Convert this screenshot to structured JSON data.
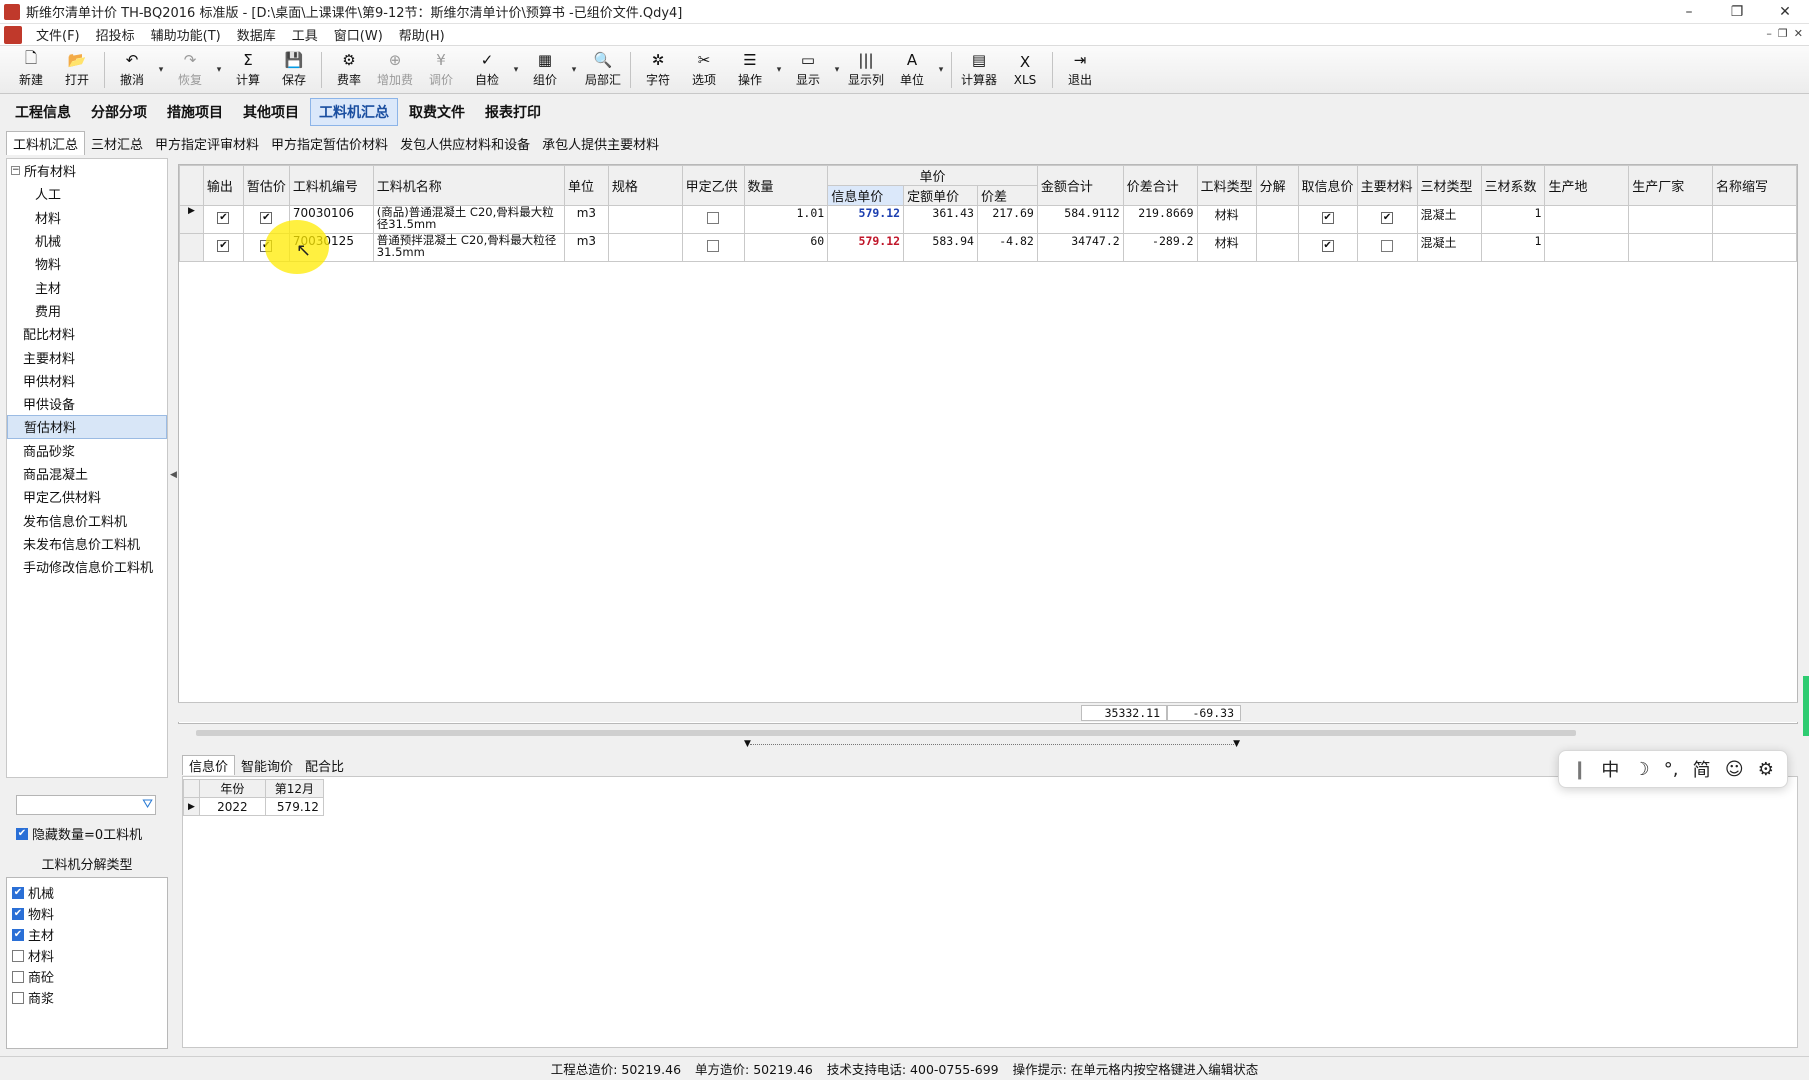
{
  "window": {
    "title": "斯维尔清单计价 TH-BQ2016 标准版 - [D:\\桌面\\上课课件\\第9-12节：斯维尔清单计价\\预算书 -已组价文件.Qdy4]",
    "minimize": "–",
    "maximize": "❐",
    "close": "✕"
  },
  "menu": {
    "items": [
      "文件(F)",
      "招投标",
      "辅助功能(T)",
      "数据库",
      "工具",
      "窗口(W)",
      "帮助(H)"
    ],
    "mdi": [
      "–",
      "❐",
      "✕"
    ]
  },
  "toolbar": {
    "buttons": [
      {
        "label": "新建",
        "icon": "new-file-icon",
        "glyph": "🗋"
      },
      {
        "label": "打开",
        "icon": "folder-open-icon",
        "glyph": "📂"
      },
      {
        "label": "撤消",
        "icon": "undo-icon",
        "glyph": "↶"
      },
      {
        "label": "恢复",
        "icon": "redo-icon",
        "glyph": "↷"
      },
      {
        "label": "计算",
        "icon": "sigma-icon",
        "glyph": "Σ"
      },
      {
        "label": "保存",
        "icon": "save-icon",
        "glyph": "💾"
      },
      {
        "label": "费率",
        "icon": "rate-icon",
        "glyph": "⚙"
      },
      {
        "label": "增加费",
        "icon": "add-fee-icon",
        "glyph": "⊕"
      },
      {
        "label": "调价",
        "icon": "price-adjust-icon",
        "glyph": "¥"
      },
      {
        "label": "自检",
        "icon": "self-check-icon",
        "glyph": "✓"
      },
      {
        "label": "组价",
        "icon": "compose-price-icon",
        "glyph": "▦"
      },
      {
        "label": "局部汇",
        "icon": "partial-summary-icon",
        "glyph": "🔍"
      },
      {
        "label": "字符",
        "icon": "symbol-icon",
        "glyph": "✲"
      },
      {
        "label": "选项",
        "icon": "options-icon",
        "glyph": "✂"
      },
      {
        "label": "操作",
        "icon": "operation-icon",
        "glyph": "☰"
      },
      {
        "label": "显示",
        "icon": "display-icon",
        "glyph": "▭"
      },
      {
        "label": "显示列",
        "icon": "columns-icon",
        "glyph": "|||"
      },
      {
        "label": "单位",
        "icon": "font-unit-icon",
        "glyph": "A"
      },
      {
        "label": "计算器",
        "icon": "calculator-icon",
        "glyph": "▤"
      },
      {
        "label": "XLS",
        "icon": "excel-icon",
        "glyph": "X"
      },
      {
        "label": "退出",
        "icon": "exit-icon",
        "glyph": "⇥"
      }
    ]
  },
  "main_tabs": [
    "工程信息",
    "分部分项",
    "措施项目",
    "其他项目",
    "工料机汇总",
    "取费文件",
    "报表打印"
  ],
  "sub_tabs": [
    "工料机汇总",
    "三材汇总",
    "甲方指定评审材料",
    "甲方指定暂估价材料",
    "发包人供应材料和设备",
    "承包人提供主要材料"
  ],
  "tree": {
    "root": "所有材料",
    "root_toggle": "−",
    "children": [
      "人工",
      "材料",
      "机械",
      "物料",
      "主材",
      "费用"
    ],
    "groups": [
      "配比材料",
      "主要材料",
      "甲供材料",
      "甲供设备",
      "暂估材料",
      "商品砂浆",
      "商品混凝土",
      "甲定乙供材料",
      "发布信息价工料机",
      "未发布信息价工料机",
      "手动修改信息价工料机"
    ],
    "selected": "暂估材料"
  },
  "filter": {
    "placeholder": "",
    "hide_zero_label": "隐藏数量=0工料机"
  },
  "decomposition": {
    "title": "工料机分解类型",
    "items": [
      {
        "label": "机械",
        "checked": true
      },
      {
        "label": "物料",
        "checked": true
      },
      {
        "label": "主材",
        "checked": true
      },
      {
        "label": "材料",
        "checked": false
      },
      {
        "label": "商砼",
        "checked": false
      },
      {
        "label": "商浆",
        "checked": false
      }
    ]
  },
  "grid": {
    "headers": {
      "output": "输出",
      "provisional": "暂估价",
      "code": "工料机编号",
      "name": "工料机名称",
      "unit": "单位",
      "spec": "规格",
      "owner_supply": "甲定乙供",
      "qty": "数量",
      "unit_price_group": "单价",
      "info_price": "信息单价",
      "quota_price": "定额单价",
      "diff": "价差",
      "amount": "金额合计",
      "diff_total": "价差合计",
      "type": "工料类型",
      "decompose": "分解",
      "take_info": "取信息价",
      "main_material": "主要材料",
      "three_type": "三材类型",
      "three_coef": "三材系数",
      "origin": "生产地",
      "maker": "生产厂家",
      "abbr": "名称缩写"
    },
    "rows": [
      {
        "code": "70030106",
        "name": "(商品)普通混凝土 C20,骨料最大粒径31.5mm",
        "unit": "m3",
        "qty": "1.01",
        "info_price": "579.12",
        "quota_price": "361.43",
        "diff": "217.69",
        "amount": "584.9112",
        "diff_total": "219.8669",
        "type": "材料",
        "three_type": "混凝土",
        "three_coef": "1",
        "main_checked": true
      },
      {
        "code": "70030125",
        "name": "普通预拌混凝土 C20,骨料最大粒径31.5mm",
        "unit": "m3",
        "qty": "60",
        "info_price": "579.12",
        "quota_price": "583.94",
        "diff": "-4.82",
        "amount": "34747.2",
        "diff_total": "-289.2",
        "type": "材料",
        "three_type": "混凝土",
        "three_coef": "1",
        "main_checked": false
      }
    ],
    "totals": {
      "amount": "35332.11",
      "diff_total": "-69.33"
    }
  },
  "bottom": {
    "tabs": [
      "信息价",
      "智能询价",
      "配合比"
    ],
    "headers": [
      "年份",
      "第12月"
    ],
    "rows": [
      [
        "2022",
        "579.12"
      ]
    ]
  },
  "ime": {
    "items": [
      "中",
      "☽",
      "°,",
      "简",
      "☺",
      "⚙"
    ]
  },
  "status": {
    "total_cost": "工程总造价: 50219.46",
    "unit_cost": "单方造价: 50219.46",
    "phone": "技术支持电话: 400-0755-699",
    "tip": "操作提示: 在单元格内按空格键进入编辑状态"
  }
}
